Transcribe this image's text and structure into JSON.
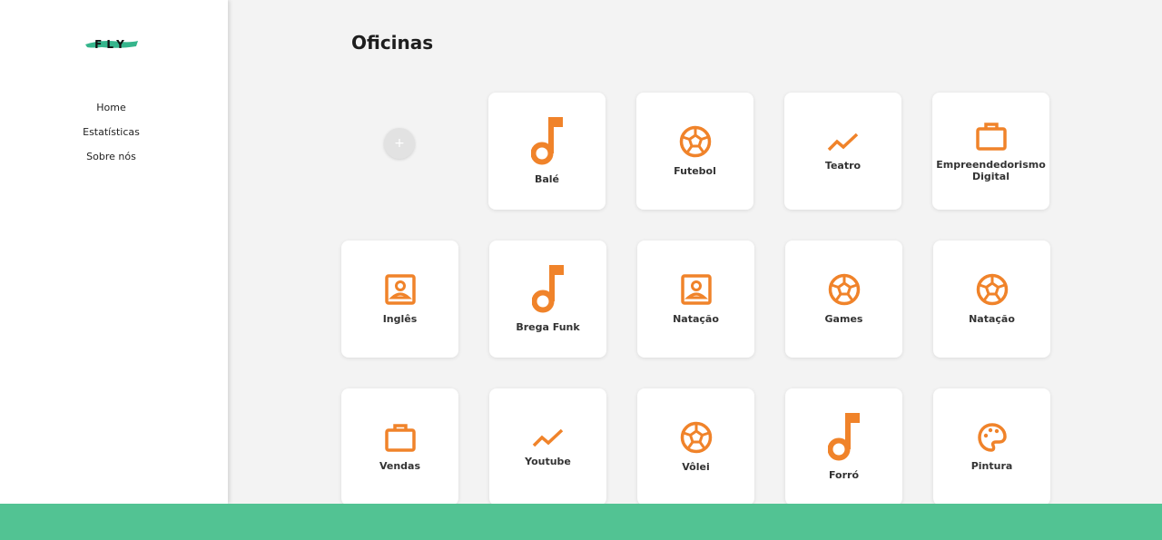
{
  "brand": {
    "logo_text": "FLY",
    "accent_color": "#52c393",
    "icon_color": "#f0832a"
  },
  "nav": {
    "items": [
      {
        "label": "Home"
      },
      {
        "label": "Estatísticas"
      },
      {
        "label": "Sobre nós"
      }
    ]
  },
  "main": {
    "title": "Oficinas",
    "add_label": "+",
    "cards": [
      {
        "label": "Balé",
        "icon": "music-note-icon"
      },
      {
        "label": "Futebol",
        "icon": "soccer-ball-icon"
      },
      {
        "label": "Teatro",
        "icon": "trending-up-icon"
      },
      {
        "label": "Empreendedorismo Digital",
        "icon": "briefcase-icon"
      },
      {
        "label": "Inglês",
        "icon": "contact-card-icon"
      },
      {
        "label": "Brega Funk",
        "icon": "music-note-icon"
      },
      {
        "label": "Natação",
        "icon": "contact-card-icon"
      },
      {
        "label": "Games",
        "icon": "soccer-ball-icon"
      },
      {
        "label": "Natação",
        "icon": "soccer-ball-icon"
      },
      {
        "label": "Vendas",
        "icon": "briefcase-icon"
      },
      {
        "label": "Youtube",
        "icon": "trending-up-icon"
      },
      {
        "label": "Vôlei",
        "icon": "soccer-ball-icon"
      },
      {
        "label": "Forró",
        "icon": "music-note-icon"
      },
      {
        "label": "Pintura",
        "icon": "palette-icon"
      }
    ]
  }
}
